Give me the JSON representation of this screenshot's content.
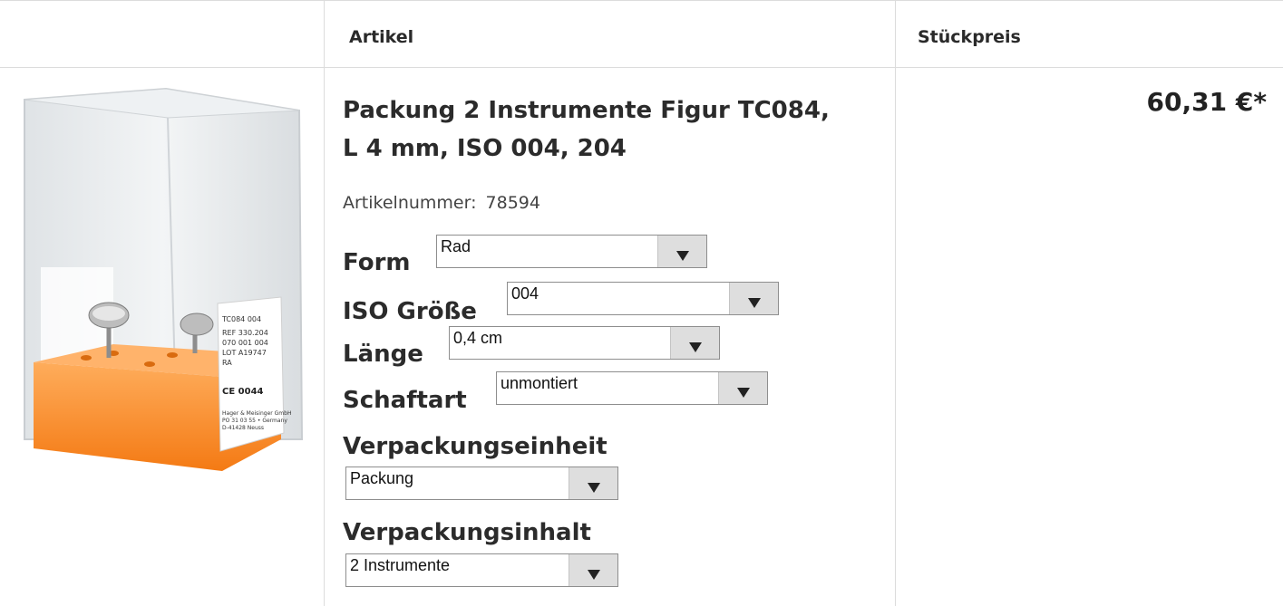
{
  "table_header": {
    "article_col": "Artikel",
    "unit_price_col": "Stückpreis"
  },
  "product": {
    "title_line1": "Packung 2 Instrumente Figur TC084,",
    "title_line2": "L 4 mm, ISO 004, 204",
    "article_number_label": "Artikelnummer:",
    "article_number": "78594",
    "price": "60,31 €*",
    "image": {
      "label_lines": [
        "TC084  004",
        "REF 330.204",
        "070 001 004",
        "LOT A19747",
        "RA"
      ],
      "ce_mark": "CE 0044",
      "maker_lines": [
        "Hager & Meisinger GmbH",
        "PO 31 03 55 • Germany",
        "D-41428 Neuss"
      ]
    }
  },
  "options": {
    "form": {
      "label": "Form",
      "value": "Rad"
    },
    "iso": {
      "label": "ISO Größe",
      "value": "004"
    },
    "laenge": {
      "label": "Länge",
      "value": "0,4 cm"
    },
    "schaftart": {
      "label": "Schaftart",
      "value": "unmontiert"
    },
    "vpe": {
      "label": "Verpackungseinheit",
      "value": "Packung"
    },
    "vpi": {
      "label": "Verpackungsinhalt",
      "value": "2 Instrumente"
    }
  },
  "colors": {
    "border": "#dcdcdc",
    "holder_orange": "#ff8a2a",
    "select_button": "#dedede"
  }
}
